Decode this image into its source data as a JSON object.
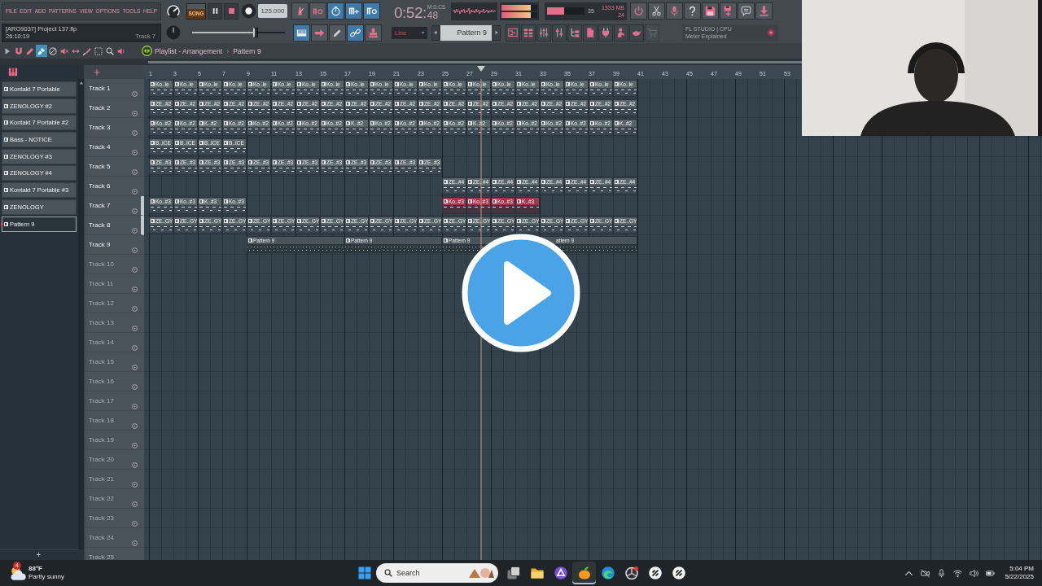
{
  "menu": [
    "FILE",
    "EDIT",
    "ADD",
    "PATTERNS",
    "VIEW",
    "OPTIONS",
    "TOOLS",
    "HELP"
  ],
  "transport": {
    "mode_label": "SONG",
    "song_mode": true,
    "playing": true,
    "recording": false,
    "tempo": "125.000"
  },
  "record_buttons": [
    {
      "on": false
    },
    {
      "on": false
    },
    {
      "on": true
    },
    {
      "on": true
    },
    {
      "on": true
    }
  ],
  "time_display": {
    "main": "0:52:",
    "format": "M:S:CS",
    "centiseconds": "48"
  },
  "output_meter": [
    {
      "level": 0.82
    },
    {
      "level": 0.82
    }
  ],
  "cpu": {
    "level": 0.45,
    "reading": "35",
    "memory": "1333 MB",
    "polyphony": "24"
  },
  "project": {
    "title": "[ARO9037] Project 137.flp",
    "elapsed": "26:10:19",
    "hint": "Track 7"
  },
  "master_slider": {
    "level": 0.68
  },
  "tool_buttons": [
    {
      "on": true
    },
    {
      "on": false
    },
    {
      "on": false
    },
    {
      "on": true
    },
    {
      "on": false
    }
  ],
  "snap": {
    "value": "Line"
  },
  "pattern_selector": {
    "value": "Pattern 9"
  },
  "window_buttons": [
    {
      "disabled": false
    },
    {
      "disabled": false
    },
    {
      "disabled": false
    },
    {
      "disabled": false
    },
    {
      "disabled": false
    },
    {
      "disabled": false
    },
    {
      "disabled": false
    },
    {
      "disabled": false
    },
    {
      "disabled": false
    },
    {
      "disabled": true
    }
  ],
  "hint_bar": {
    "title": "FL STUDIO | CPU",
    "message": "Meter Explained"
  },
  "playlist": {
    "tools": [
      {
        "selected": false
      },
      {
        "selected": false
      },
      {
        "selected": false
      },
      {
        "selected": true
      },
      {
        "selected": false
      },
      {
        "selected": false
      },
      {
        "selected": false
      },
      {
        "selected": false
      },
      {
        "selected": false
      },
      {
        "selected": false
      },
      {
        "selected": false
      }
    ],
    "title": "Playlist - Arrangement",
    "separator": "›",
    "pattern": "Pattern 9"
  },
  "pattern_list": [
    {
      "name": "Kontakt 7 Portable",
      "selected": false
    },
    {
      "name": "ZENOLOGY #2",
      "selected": false
    },
    {
      "name": "Kontakt 7 Portable #2",
      "selected": false
    },
    {
      "name": "Bass - NOTICE",
      "selected": false
    },
    {
      "name": "ZENOLOGY #3",
      "selected": false
    },
    {
      "name": "ZENOLOGY #4",
      "selected": false
    },
    {
      "name": "Kontakt 7 Portable #3",
      "selected": false
    },
    {
      "name": "ZENOLOGY",
      "selected": false
    },
    {
      "name": "Pattern 9",
      "selected": true
    }
  ],
  "pattern_add": "+",
  "ruler": [
    "1",
    "3",
    "5",
    "7",
    "9",
    "11",
    "13",
    "15",
    "17",
    "19",
    "21",
    "23",
    "25",
    "27",
    "29",
    "31",
    "33",
    "35",
    "37",
    "39",
    "41",
    "43",
    "45",
    "47",
    "49",
    "51",
    "53"
  ],
  "tracks": [
    {
      "name": "Track 1",
      "empty": false,
      "selected": false,
      "clips": [
        {
          "kind": "clip",
          "label": "Ko..le",
          "selected": false
        },
        {
          "kind": "clip",
          "label": "Ko..le",
          "selected": false
        },
        {
          "kind": "clip",
          "label": "Ko..le",
          "selected": false
        },
        {
          "kind": "clip",
          "label": "Ko..le",
          "selected": false
        },
        {
          "kind": "clip",
          "label": "Ko..le",
          "selected": false
        },
        {
          "kind": "clip",
          "label": "Ko..le",
          "selected": false
        },
        {
          "kind": "clip",
          "label": "Ko..le",
          "selected": false
        },
        {
          "kind": "clip",
          "label": "Ko..le",
          "selected": false
        },
        {
          "kind": "clip",
          "label": "Ko..le",
          "selected": false
        },
        {
          "kind": "clip",
          "label": "Ko..le",
          "selected": false
        },
        {
          "kind": "clip",
          "label": "Ko..le",
          "selected": false
        },
        {
          "kind": "clip",
          "label": "Ko..le",
          "selected": false
        },
        {
          "kind": "clip",
          "label": "Ko..le",
          "selected": false
        },
        {
          "kind": "clip",
          "label": "Ko..le",
          "selected": false
        },
        {
          "kind": "clip",
          "label": "Ko..le",
          "selected": false
        },
        {
          "kind": "clip",
          "label": "Ko..le",
          "selected": false
        },
        {
          "kind": "clip",
          "label": "Ko..le",
          "selected": false
        },
        {
          "kind": "clip",
          "label": "Ko..le",
          "selected": false
        },
        {
          "kind": "clip",
          "label": "Ko..le",
          "selected": false
        },
        {
          "kind": "clip",
          "label": "Ko..le",
          "selected": false
        }
      ]
    },
    {
      "name": "Track 2",
      "empty": false,
      "selected": false,
      "clips": [
        {
          "kind": "clip",
          "label": "ZE..#2",
          "selected": false
        },
        {
          "kind": "clip",
          "label": "ZE..#2",
          "selected": false
        },
        {
          "kind": "clip",
          "label": "ZE..#2",
          "selected": false
        },
        {
          "kind": "clip",
          "label": "ZE..#2",
          "selected": false
        },
        {
          "kind": "clip",
          "label": "ZE..#2",
          "selected": false
        },
        {
          "kind": "clip",
          "label": "ZE..#2",
          "selected": false
        },
        {
          "kind": "clip",
          "label": "ZE..#2",
          "selected": false
        },
        {
          "kind": "clip",
          "label": "ZE..#2",
          "selected": false
        },
        {
          "kind": "clip",
          "label": "ZE..#2",
          "selected": false
        },
        {
          "kind": "clip",
          "label": "ZE..#2",
          "selected": false
        },
        {
          "kind": "clip",
          "label": "ZE..#2",
          "selected": false
        },
        {
          "kind": "clip",
          "label": "ZE..#2",
          "selected": false
        },
        {
          "kind": "clip",
          "label": "ZE..#2",
          "selected": false
        },
        {
          "kind": "clip",
          "label": "ZE..#2",
          "selected": false
        },
        {
          "kind": "clip",
          "label": "ZE..#2",
          "selected": false
        },
        {
          "kind": "clip",
          "label": "ZE..#2",
          "selected": false
        },
        {
          "kind": "clip",
          "label": "ZE..#2",
          "selected": false
        },
        {
          "kind": "clip",
          "label": "ZE..#2",
          "selected": false
        },
        {
          "kind": "clip",
          "label": "ZE..#2",
          "selected": false
        },
        {
          "kind": "clip",
          "label": "ZE..#2",
          "selected": false
        }
      ]
    },
    {
      "name": "Track 3",
      "empty": false,
      "selected": false,
      "clips": [
        {
          "kind": "clip",
          "label": "Ko..#2",
          "selected": false
        },
        {
          "kind": "clip",
          "label": "Ko..#2",
          "selected": false
        },
        {
          "kind": "clip",
          "label": "K..#2",
          "selected": false
        },
        {
          "kind": "clip",
          "label": "Ko..#2",
          "selected": false
        },
        {
          "kind": "clip",
          "label": "Ko..#2",
          "selected": false
        },
        {
          "kind": "clip",
          "label": "Ko..#2",
          "selected": false
        },
        {
          "kind": "clip",
          "label": "Ko..#2",
          "selected": false
        },
        {
          "kind": "clip",
          "label": "Ko..#2",
          "selected": false
        },
        {
          "kind": "clip",
          "label": "K..#2",
          "selected": false
        },
        {
          "kind": "clip",
          "label": "Ko..#2",
          "selected": false
        },
        {
          "kind": "clip",
          "label": "Ko..#2",
          "selected": false
        },
        {
          "kind": "clip",
          "label": "Ko..#2",
          "selected": false
        },
        {
          "kind": "clip",
          "label": "Ko..#2",
          "selected": false
        },
        {
          "kind": "clip",
          "label": "K..#2",
          "selected": false
        },
        {
          "kind": "clip",
          "label": "Ko..#2",
          "selected": false
        },
        {
          "kind": "clip",
          "label": "Ko..#2",
          "selected": false
        },
        {
          "kind": "clip",
          "label": "Ko..#2",
          "selected": false
        },
        {
          "kind": "clip",
          "label": "Ko..#2",
          "selected": false
        },
        {
          "kind": "clip",
          "label": "Ko..#2",
          "selected": false
        },
        {
          "kind": "clip",
          "label": "K..#2",
          "selected": false
        }
      ]
    },
    {
      "name": "Track 4",
      "empty": false,
      "selected": false,
      "clips": [
        {
          "kind": "clip",
          "label": "B..ICE",
          "selected": false
        },
        {
          "kind": "clip",
          "label": "B..ICE",
          "selected": false
        },
        {
          "kind": "clip",
          "label": "B..ICE",
          "selected": false
        },
        {
          "kind": "clip",
          "label": "B..ICE",
          "selected": false
        }
      ]
    },
    {
      "name": "Track 5",
      "empty": false,
      "selected": false,
      "clips": [
        {
          "kind": "clip",
          "label": "ZE..#3",
          "selected": false
        },
        {
          "kind": "clip",
          "label": "ZE..#3",
          "selected": false
        },
        {
          "kind": "clip",
          "label": "ZE..#3",
          "selected": false
        },
        {
          "kind": "clip",
          "label": "ZE..#3",
          "selected": false
        },
        {
          "kind": "clip",
          "label": "ZE..#3",
          "selected": false
        },
        {
          "kind": "clip",
          "label": "ZE..#3",
          "selected": false
        },
        {
          "kind": "clip",
          "label": "ZE..#3",
          "selected": false
        },
        {
          "kind": "clip",
          "label": "ZE..#3",
          "selected": false
        },
        {
          "kind": "clip",
          "label": "ZE..#3",
          "selected": false
        },
        {
          "kind": "clip",
          "label": "ZE..#3",
          "selected": false
        },
        {
          "kind": "clip",
          "label": "ZE..#3",
          "selected": false
        },
        {
          "kind": "clip",
          "label": "ZE..#3",
          "selected": false
        }
      ]
    },
    {
      "name": "Track 6",
      "empty": false,
      "selected": false,
      "clips": [
        {
          "kind": "gap"
        },
        {
          "kind": "gap"
        },
        {
          "kind": "gap"
        },
        {
          "kind": "gap"
        },
        {
          "kind": "gap"
        },
        {
          "kind": "gap"
        },
        {
          "kind": "gap"
        },
        {
          "kind": "gap"
        },
        {
          "kind": "gap"
        },
        {
          "kind": "gap"
        },
        {
          "kind": "gap"
        },
        {
          "kind": "gap"
        },
        {
          "kind": "clip",
          "label": "ZE..#4",
          "selected": false
        },
        {
          "kind": "clip",
          "label": "ZE..#4",
          "selected": false
        },
        {
          "kind": "clip",
          "label": "ZE..#4",
          "selected": false
        },
        {
          "kind": "clip",
          "label": "ZE..#4",
          "selected": false
        },
        {
          "kind": "clip",
          "label": "ZE..#4",
          "selected": false
        },
        {
          "kind": "clip",
          "label": "ZE..#4",
          "selected": false
        },
        {
          "kind": "clip",
          "label": "ZE..#4",
          "selected": false
        },
        {
          "kind": "clip",
          "label": "ZE..#4",
          "selected": false
        }
      ]
    },
    {
      "name": "Track 7",
      "empty": false,
      "selected": true,
      "clips": [
        {
          "kind": "clip",
          "label": "Ko..#3",
          "selected": false
        },
        {
          "kind": "clip",
          "label": "Ko..#3",
          "selected": false
        },
        {
          "kind": "clip",
          "label": "K..#3",
          "selected": false
        },
        {
          "kind": "clip",
          "label": "Ko..#3",
          "selected": false
        },
        {
          "kind": "gap"
        },
        {
          "kind": "gap"
        },
        {
          "kind": "gap"
        },
        {
          "kind": "gap"
        },
        {
          "kind": "gap"
        },
        {
          "kind": "gap"
        },
        {
          "kind": "gap"
        },
        {
          "kind": "gap"
        },
        {
          "kind": "clip",
          "label": "Ko..#3",
          "selected": true
        },
        {
          "kind": "clip",
          "label": "Ko..#3",
          "selected": true
        },
        {
          "kind": "clip",
          "label": "Ko..#3",
          "selected": true
        },
        {
          "kind": "clip",
          "label": "K..#3",
          "selected": true
        }
      ]
    },
    {
      "name": "Track 8",
      "empty": false,
      "selected": true,
      "clips": [
        {
          "kind": "clip",
          "label": "ZE..GY",
          "selected": false
        },
        {
          "kind": "clip",
          "label": "ZE..GY",
          "selected": false
        },
        {
          "kind": "clip",
          "label": "ZE..GY",
          "selected": false
        },
        {
          "kind": "clip",
          "label": "ZE..GY",
          "selected": false
        },
        {
          "kind": "clip",
          "label": "ZE..GY",
          "selected": false
        },
        {
          "kind": "clip",
          "label": "ZE..GY",
          "selected": false
        },
        {
          "kind": "clip",
          "label": "ZE..GY",
          "selected": false
        },
        {
          "kind": "clip",
          "label": "ZE..GY",
          "selected": false
        },
        {
          "kind": "clip",
          "label": "ZE..GY",
          "selected": false
        },
        {
          "kind": "clip",
          "label": "ZE..GY",
          "selected": false
        },
        {
          "kind": "clip",
          "label": "ZE..GY",
          "selected": false
        },
        {
          "kind": "clip",
          "label": "ZE..GY",
          "selected": false
        },
        {
          "kind": "clip",
          "label": "ZE..GY",
          "selected": false
        },
        {
          "kind": "clip",
          "label": "ZE..GY",
          "selected": false
        },
        {
          "kind": "clip",
          "label": "ZE..GY",
          "selected": false
        },
        {
          "kind": "clip",
          "label": "ZE..GY",
          "selected": false
        },
        {
          "kind": "clip",
          "label": "ZE..GY",
          "selected": false
        },
        {
          "kind": "clip",
          "label": "ZE..GY",
          "selected": false
        },
        {
          "kind": "clip",
          "label": "ZE..GY",
          "selected": false
        },
        {
          "kind": "clip",
          "label": "ZE..GY",
          "selected": false
        }
      ]
    },
    {
      "name": "Track 9",
      "empty": false,
      "selected": false,
      "clips": [
        {
          "kind": "gap"
        },
        {
          "kind": "gap"
        },
        {
          "kind": "gap"
        },
        {
          "kind": "gap"
        },
        {
          "kind": "long-clip",
          "label": "Pattern 9",
          "selected": false,
          "covered": false
        },
        {
          "kind": "long-clip",
          "label": "Pattern 9",
          "selected": false,
          "covered": false
        },
        {
          "kind": "long-clip",
          "label": "Pattern 9",
          "selected": false,
          "covered": false
        },
        {
          "kind": "long-clip",
          "label": "attern 9",
          "selected": false,
          "covered": true
        }
      ]
    },
    {
      "name": "Track 10",
      "empty": true,
      "selected": false
    },
    {
      "name": "Track 11",
      "empty": true,
      "selected": false
    },
    {
      "name": "Track 12",
      "empty": true,
      "selected": false
    },
    {
      "name": "Track 13",
      "empty": true,
      "selected": false
    },
    {
      "name": "Track 14",
      "empty": true,
      "selected": false
    },
    {
      "name": "Track 15",
      "empty": true,
      "selected": false
    },
    {
      "name": "Track 16",
      "empty": true,
      "selected": false
    },
    {
      "name": "Track 17",
      "empty": true,
      "selected": false
    },
    {
      "name": "Track 18",
      "empty": true,
      "selected": false
    },
    {
      "name": "Track 19",
      "empty": true,
      "selected": false
    },
    {
      "name": "Track 20",
      "empty": true,
      "selected": false
    },
    {
      "name": "Track 21",
      "empty": true,
      "selected": false
    },
    {
      "name": "Track 22",
      "empty": true,
      "selected": false
    },
    {
      "name": "Track 23",
      "empty": true,
      "selected": false
    },
    {
      "name": "Track 24",
      "empty": true,
      "selected": false
    },
    {
      "name": "Track 25",
      "empty": true,
      "selected": false
    }
  ],
  "taskbar": {
    "weather": {
      "badge": "4",
      "temperature": "88°F",
      "condition": "Partly sunny"
    },
    "search": {
      "placeholder": "Search"
    },
    "apps": [
      {
        "active": false
      },
      {
        "active": false
      },
      {
        "active": false
      },
      {
        "active": true
      },
      {
        "active": false
      },
      {
        "active": false
      },
      {
        "active": false
      },
      {
        "active": false
      }
    ],
    "clock": {
      "time": "5:04 PM",
      "date": "5/22/2025"
    }
  }
}
